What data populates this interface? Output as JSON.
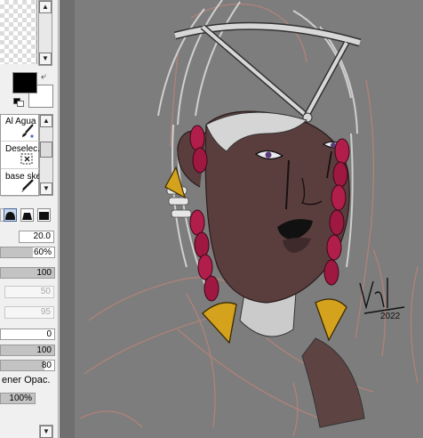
{
  "tools": [
    {
      "label": "Al Agua",
      "icon": "paint-brush-icon"
    },
    {
      "label": "Deselec.",
      "icon": "deselect-icon"
    },
    {
      "label": "base ske",
      "icon": "pen-icon"
    }
  ],
  "brush": {
    "size_value": "20.0",
    "min_size_value": "60%",
    "density_value": "100",
    "blending_value": "50",
    "dilution_value": "95",
    "persistence_value": "0",
    "field_a_value": "100",
    "field_b_value": "80",
    "keep_opacity_label": "ener Opac.",
    "keep_opacity_value": "100%"
  },
  "signature": "Val 2022",
  "colors": {
    "foreground": "#000000",
    "background": "#ffffff",
    "canvas_bg": "#7d7d7d",
    "skin": "#5a3e3e",
    "braids": "#b21e4b",
    "gold": "#d4a21c",
    "sketch_line": "#b98477"
  }
}
